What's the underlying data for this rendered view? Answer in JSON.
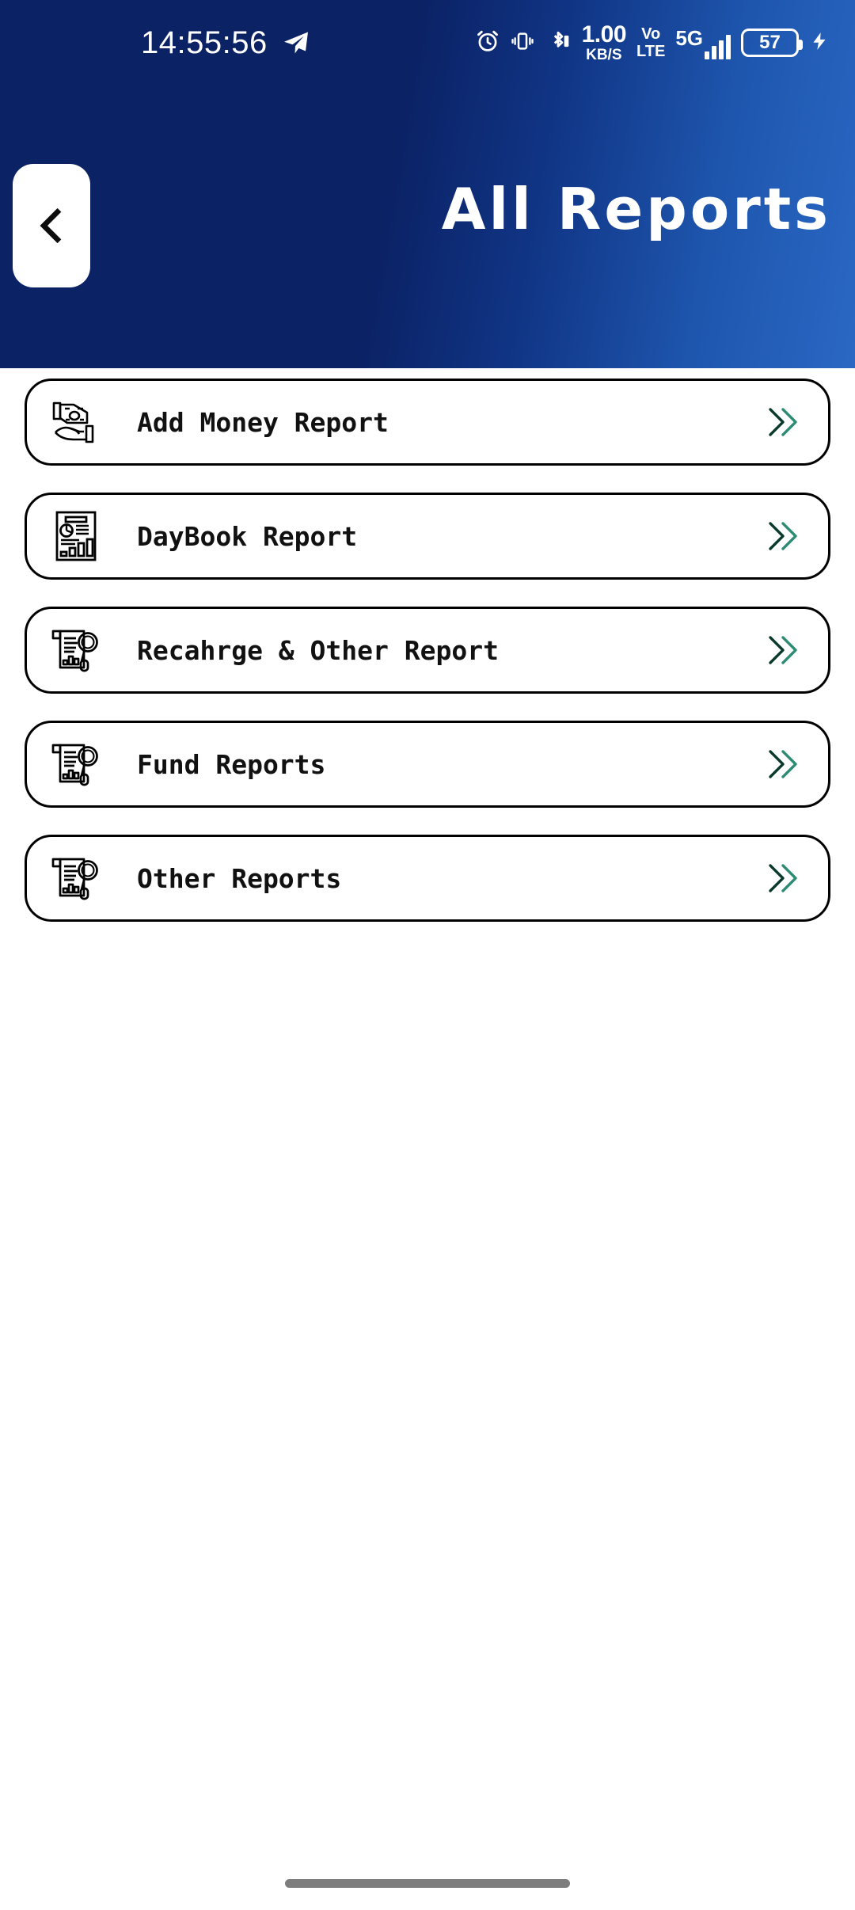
{
  "status_bar": {
    "time": "14:55:56",
    "telegram_icon": "telegram-paper-plane-icon",
    "alarm_icon": "alarm-clock-icon",
    "vibrate_icon": "vibrate-icon",
    "bluetooth_icon": "bluetooth-icon",
    "network_speed_value": "1.00",
    "network_speed_unit": "KB/S",
    "volte_line1": "Vo",
    "volte_line2": "LTE",
    "network_type": "5G",
    "signal_icon": "signal-bars-icon",
    "battery_percent": "57",
    "charging_icon": "charging-bolt-icon"
  },
  "header": {
    "title": "All Reports",
    "back_label": "Back",
    "gradient_start": "#0b2265",
    "gradient_end": "#2a68c4"
  },
  "reports": {
    "items": [
      {
        "label": "Add Money Report",
        "icon": "hand-money-icon"
      },
      {
        "label": "DayBook Report",
        "icon": "report-document-chart-icon"
      },
      {
        "label": "Recahrge & Other Report",
        "icon": "scroll-magnifier-icon"
      },
      {
        "label": "Fund Reports",
        "icon": "scroll-magnifier-icon"
      },
      {
        "label": "Other Reports",
        "icon": "scroll-magnifier-icon"
      }
    ],
    "chevron_icon": "double-chevron-right-icon",
    "chevron_color_dark": "#0a3a2c",
    "chevron_color_light": "#2e8b74",
    "card_border_color": "#000000"
  },
  "system_nav": {
    "home_indicator": "home-indicator-pill",
    "color": "#7d7d7d"
  }
}
